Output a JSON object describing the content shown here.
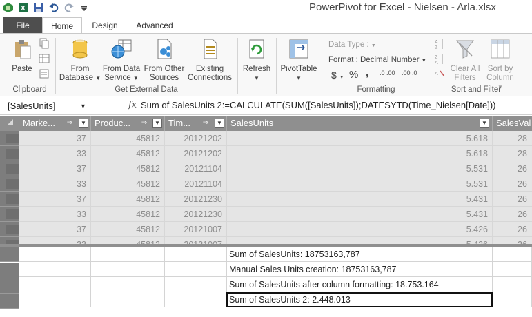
{
  "window": {
    "title": "PowerPivot for Excel - Nielsen - Arla.xlsx"
  },
  "quick_access": [
    {
      "icon": "powerpivot-icon"
    },
    {
      "icon": "excel-icon"
    },
    {
      "icon": "save-icon"
    },
    {
      "icon": "undo-icon"
    },
    {
      "icon": "redo-icon"
    },
    {
      "icon": "customize-icon"
    }
  ],
  "tabs": [
    {
      "label": "File"
    },
    {
      "label": "Home"
    },
    {
      "label": "Design"
    },
    {
      "label": "Advanced"
    }
  ],
  "ribbon": {
    "clipboard": {
      "paste": "Paste",
      "group": "Clipboard"
    },
    "external": {
      "from_database_1": "From",
      "from_database_2": "Database",
      "from_data_service_1": "From Data",
      "from_data_service_2": "Service",
      "from_other_1": "From Other",
      "from_other_2": "Sources",
      "existing_1": "Existing",
      "existing_2": "Connections",
      "group": "Get External Data"
    },
    "refresh": "Refresh",
    "pivottable": "PivotTable",
    "formatting": {
      "data_type": "Data Type :",
      "format": "Format : Decimal Number",
      "currency": "$",
      "percent": "%",
      "comma": ",",
      "inc_decimal": ".0 .00",
      "dec_decimal": ".00 .0",
      "group": "Formatting"
    },
    "sort_filter": {
      "clear_1": "Clear All",
      "clear_2": "Filters",
      "sort_col_1": "Sort by",
      "sort_col_2": "Column",
      "group": "Sort and Filter"
    }
  },
  "formula_bar": {
    "name_box": "[SalesUnits]",
    "fx": "fx",
    "formula": "Sum of SalesUnits 2:=CALCULATE(SUM([SalesUnits]);DATESYTD(Time_Nielsen[Date]))"
  },
  "columns": [
    {
      "label": "Marke..."
    },
    {
      "label": "Produc..."
    },
    {
      "label": "Tim..."
    },
    {
      "label": "SalesUnits"
    },
    {
      "label": "SalesVal"
    }
  ],
  "rows": [
    [
      "37",
      "45812",
      "20121202",
      "5.618",
      "28"
    ],
    [
      "33",
      "45812",
      "20121202",
      "5.618",
      "28"
    ],
    [
      "37",
      "45812",
      "20121104",
      "5.531",
      "26"
    ],
    [
      "33",
      "45812",
      "20121104",
      "5.531",
      "26"
    ],
    [
      "37",
      "45812",
      "20121230",
      "5.431",
      "26"
    ],
    [
      "33",
      "45812",
      "20121230",
      "5.431",
      "26"
    ],
    [
      "37",
      "45812",
      "20121007",
      "5.426",
      "26"
    ],
    [
      "33",
      "45812",
      "20121007",
      "5.426",
      "26"
    ]
  ],
  "measures": [
    "Sum of SalesUnits: 18753163,787",
    "Manual Sales Units creation: 18753163,787",
    "Sum of SalesUnits after column formatting: 18.753.164",
    "Sum of SalesUnits 2: 2.448.013"
  ]
}
